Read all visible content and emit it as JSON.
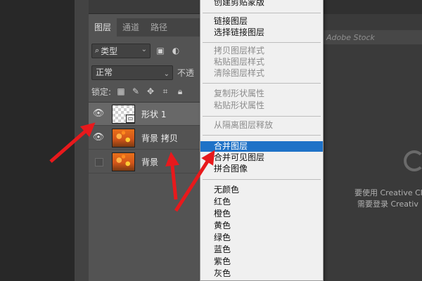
{
  "layers_panel": {
    "tabs": [
      {
        "label": "图层",
        "active": true
      },
      {
        "label": "通道",
        "active": false
      },
      {
        "label": "路径",
        "active": false
      }
    ],
    "filter": {
      "kind_label": "类型",
      "search_glyph": "🔍"
    },
    "blend_mode": "正常",
    "opacity_label": "不透",
    "lock_label": "锁定:",
    "layers": [
      {
        "name": "形状 1",
        "visible": true,
        "selected": true,
        "thumb": "checker-shape"
      },
      {
        "name": "背景 拷贝",
        "visible": true,
        "selected": false,
        "thumb": "flowers"
      },
      {
        "name": "背景",
        "visible": false,
        "selected": false,
        "thumb": "flowers"
      }
    ]
  },
  "workspace": {
    "stock_text": "Adobe Stock",
    "cc_line1": "要使用 Creative Cl",
    "cc_line2": "需要登录 Creativ"
  },
  "context_menu": {
    "highlight_color": "#1f72c7",
    "items": {
      "create_clipping": "创建剪贴蒙版",
      "link_layers": "链接图层",
      "select_linked": "选择链接图层",
      "copy_style": "拷贝图层样式",
      "paste_style": "粘贴图层样式",
      "clear_style": "清除图层样式",
      "copy_shape_attrs": "复制形状属性",
      "paste_shape_attrs": "粘贴形状属性",
      "release_isolation": "从隔离图层释放",
      "merge_layers": "合并图层",
      "merge_visible": "合并可见图层",
      "flatten_image": "拼合图像",
      "no_color": "无颜色",
      "red": "红色",
      "orange": "橙色",
      "yellow": "黄色",
      "green": "绿色",
      "blue": "蓝色",
      "violet": "紫色",
      "gray": "灰色"
    }
  },
  "annotation_color": "#e8191c"
}
